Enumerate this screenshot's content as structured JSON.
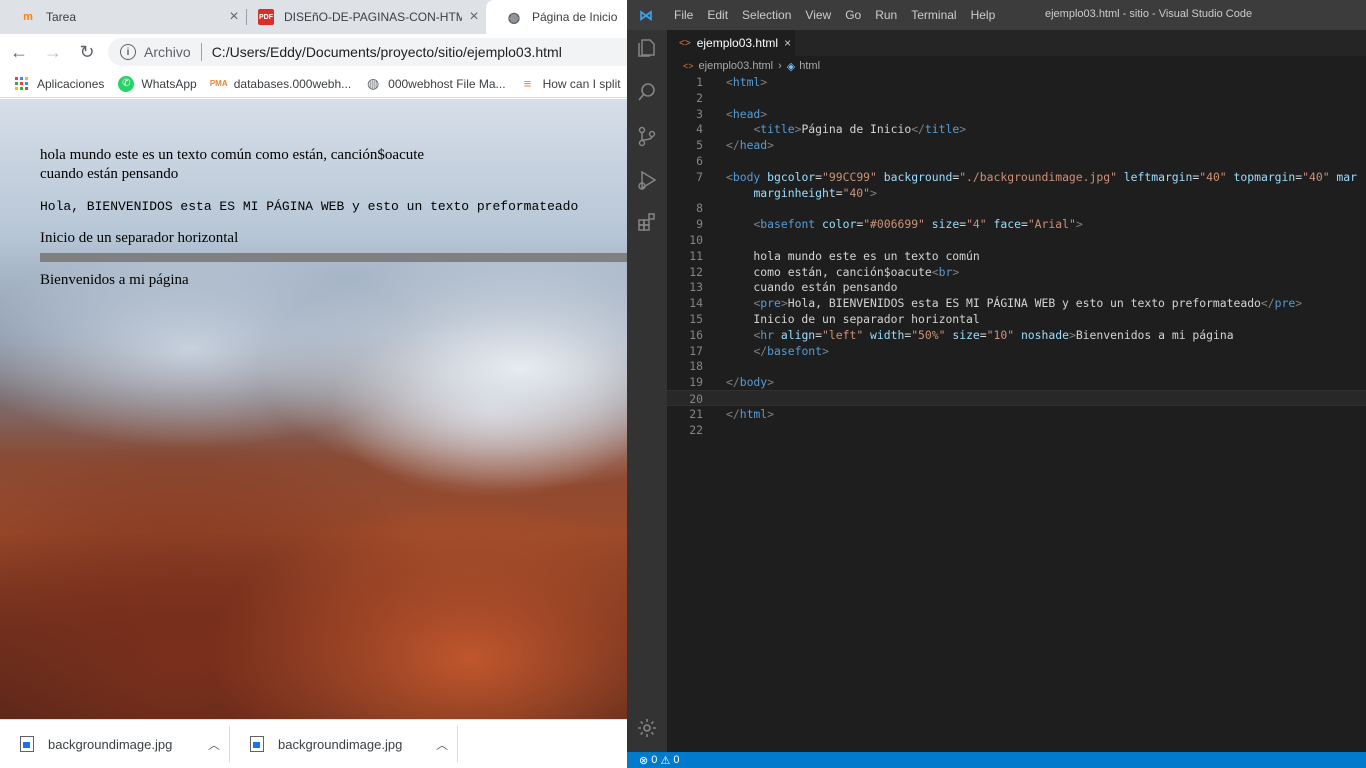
{
  "browser": {
    "tabs": [
      {
        "label": "Tarea",
        "icon": "moodle-icon"
      },
      {
        "label": "DISEñO-DE-PAGINAS-CON-HTM",
        "icon": "pdf-icon"
      },
      {
        "label": "Página de Inicio",
        "icon": "globe-icon"
      }
    ],
    "address_scheme": "Archivo",
    "address_url": "C:/Users/Eddy/Documents/proyecto/sitio/ejemplo03.html",
    "bookmarks": [
      {
        "label": "Aplicaciones",
        "icon": "apps-grid-icon"
      },
      {
        "label": "WhatsApp",
        "icon": "whatsapp-icon"
      },
      {
        "label": "databases.000webh...",
        "icon": "phpmyadmin-icon"
      },
      {
        "label": "000webhost File Ma...",
        "icon": "globe-icon"
      },
      {
        "label": "How can I split",
        "icon": "stackoverflow-icon"
      }
    ],
    "page": {
      "line1": "hola mundo este es un texto común como están, canción$oacute",
      "line2": "cuando están pensando",
      "pre": "Hola, BIENVENIDOS esta ES MI PÁGINA WEB y esto un texto preformateado",
      "separator_text": "Inicio de un separador horizontal",
      "welcome": "Bienvenidos a mi página"
    },
    "downloads": [
      {
        "name": "backgroundimage.jpg"
      },
      {
        "name": "backgroundimage.jpg"
      }
    ]
  },
  "vscode": {
    "menu": [
      "File",
      "Edit",
      "Selection",
      "View",
      "Go",
      "Run",
      "Terminal",
      "Help"
    ],
    "window_title": "ejemplo03.html - sitio - Visual Studio Code",
    "tab_label": "ejemplo03.html",
    "breadcrumb_file": "ejemplo03.html",
    "breadcrumb_symbol": "html",
    "status_errors": "0",
    "status_warnings": "0",
    "code_lines": [
      {
        "n": "1",
        "tokens": [
          {
            "t": "br",
            "v": "<"
          },
          {
            "t": "tg",
            "v": "html"
          },
          {
            "t": "br",
            "v": ">"
          }
        ]
      },
      {
        "n": "2",
        "tokens": []
      },
      {
        "n": "3",
        "tokens": [
          {
            "t": "br",
            "v": "<"
          },
          {
            "t": "tg",
            "v": "head"
          },
          {
            "t": "br",
            "v": ">"
          }
        ]
      },
      {
        "n": "4",
        "tokens": [
          {
            "t": "tx",
            "v": "    "
          },
          {
            "t": "br",
            "v": "<"
          },
          {
            "t": "tg",
            "v": "title"
          },
          {
            "t": "br",
            "v": ">"
          },
          {
            "t": "tx",
            "v": "Página de Inicio"
          },
          {
            "t": "br",
            "v": "</"
          },
          {
            "t": "tg",
            "v": "title"
          },
          {
            "t": "br",
            "v": ">"
          }
        ]
      },
      {
        "n": "5",
        "tokens": [
          {
            "t": "br",
            "v": "</"
          },
          {
            "t": "tg",
            "v": "head"
          },
          {
            "t": "br",
            "v": ">"
          }
        ]
      },
      {
        "n": "6",
        "tokens": []
      },
      {
        "n": "7",
        "tokens": [
          {
            "t": "br",
            "v": "<"
          },
          {
            "t": "tg",
            "v": "body"
          },
          {
            "t": "tx",
            "v": " "
          },
          {
            "t": "at",
            "v": "bgcolor"
          },
          {
            "t": "tx",
            "v": "="
          },
          {
            "t": "st",
            "v": "\"99CC99\""
          },
          {
            "t": "tx",
            "v": " "
          },
          {
            "t": "at",
            "v": "background"
          },
          {
            "t": "tx",
            "v": "="
          },
          {
            "t": "st",
            "v": "\"./backgroundimage.jpg\""
          },
          {
            "t": "tx",
            "v": " "
          },
          {
            "t": "at",
            "v": "leftmargin"
          },
          {
            "t": "tx",
            "v": "="
          },
          {
            "t": "st",
            "v": "\"40\""
          },
          {
            "t": "tx",
            "v": " "
          },
          {
            "t": "at",
            "v": "topmargin"
          },
          {
            "t": "tx",
            "v": "="
          },
          {
            "t": "st",
            "v": "\"40\""
          },
          {
            "t": "tx",
            "v": " "
          },
          {
            "t": "at",
            "v": "mar"
          }
        ]
      },
      {
        "n": "",
        "tokens": [
          {
            "t": "tx",
            "v": "    "
          },
          {
            "t": "at",
            "v": "marginheight"
          },
          {
            "t": "tx",
            "v": "="
          },
          {
            "t": "st",
            "v": "\"40\""
          },
          {
            "t": "br",
            "v": ">"
          }
        ]
      },
      {
        "n": "8",
        "tokens": []
      },
      {
        "n": "9",
        "tokens": [
          {
            "t": "tx",
            "v": "    "
          },
          {
            "t": "br",
            "v": "<"
          },
          {
            "t": "tg",
            "v": "basefont"
          },
          {
            "t": "tx",
            "v": " "
          },
          {
            "t": "at",
            "v": "color"
          },
          {
            "t": "tx",
            "v": "="
          },
          {
            "t": "st",
            "v": "\"#006699\""
          },
          {
            "t": "tx",
            "v": " "
          },
          {
            "t": "at",
            "v": "size"
          },
          {
            "t": "tx",
            "v": "="
          },
          {
            "t": "st",
            "v": "\"4\""
          },
          {
            "t": "tx",
            "v": " "
          },
          {
            "t": "at",
            "v": "face"
          },
          {
            "t": "tx",
            "v": "="
          },
          {
            "t": "st",
            "v": "\"Arial\""
          },
          {
            "t": "br",
            "v": ">"
          }
        ]
      },
      {
        "n": "10",
        "tokens": []
      },
      {
        "n": "11",
        "tokens": [
          {
            "t": "tx",
            "v": "    hola mundo este es un texto común"
          }
        ]
      },
      {
        "n": "12",
        "tokens": [
          {
            "t": "tx",
            "v": "    como están, canción$oacute"
          },
          {
            "t": "br",
            "v": "<"
          },
          {
            "t": "tg",
            "v": "br"
          },
          {
            "t": "br",
            "v": ">"
          }
        ]
      },
      {
        "n": "13",
        "tokens": [
          {
            "t": "tx",
            "v": "    cuando están pensando"
          }
        ]
      },
      {
        "n": "14",
        "tokens": [
          {
            "t": "tx",
            "v": "    "
          },
          {
            "t": "br",
            "v": "<"
          },
          {
            "t": "tg",
            "v": "pre"
          },
          {
            "t": "br",
            "v": ">"
          },
          {
            "t": "tx",
            "v": "Hola, BIENVENIDOS esta ES MI PÁGINA WEB y esto un texto preformateado"
          },
          {
            "t": "br",
            "v": "</"
          },
          {
            "t": "tg",
            "v": "pre"
          },
          {
            "t": "br",
            "v": ">"
          }
        ]
      },
      {
        "n": "15",
        "tokens": [
          {
            "t": "tx",
            "v": "    Inicio de un separador horizontal"
          }
        ]
      },
      {
        "n": "16",
        "tokens": [
          {
            "t": "tx",
            "v": "    "
          },
          {
            "t": "br",
            "v": "<"
          },
          {
            "t": "tg",
            "v": "hr"
          },
          {
            "t": "tx",
            "v": " "
          },
          {
            "t": "at",
            "v": "align"
          },
          {
            "t": "tx",
            "v": "="
          },
          {
            "t": "st",
            "v": "\"left\""
          },
          {
            "t": "tx",
            "v": " "
          },
          {
            "t": "at",
            "v": "width"
          },
          {
            "t": "tx",
            "v": "="
          },
          {
            "t": "st",
            "v": "\"50%\""
          },
          {
            "t": "tx",
            "v": " "
          },
          {
            "t": "at",
            "v": "size"
          },
          {
            "t": "tx",
            "v": "="
          },
          {
            "t": "st",
            "v": "\"10\""
          },
          {
            "t": "tx",
            "v": " "
          },
          {
            "t": "at",
            "v": "noshade"
          },
          {
            "t": "br",
            "v": ">"
          },
          {
            "t": "tx",
            "v": "Bienvenidos a mi página"
          }
        ]
      },
      {
        "n": "17",
        "tokens": [
          {
            "t": "tx",
            "v": "    "
          },
          {
            "t": "br",
            "v": "</"
          },
          {
            "t": "tg",
            "v": "basefont"
          },
          {
            "t": "br",
            "v": ">"
          }
        ]
      },
      {
        "n": "18",
        "tokens": []
      },
      {
        "n": "19",
        "tokens": [
          {
            "t": "br",
            "v": "</"
          },
          {
            "t": "tg",
            "v": "body"
          },
          {
            "t": "br",
            "v": ">"
          }
        ]
      },
      {
        "n": "20",
        "tokens": [],
        "current": true
      },
      {
        "n": "21",
        "tokens": [
          {
            "t": "br",
            "v": "</"
          },
          {
            "t": "tg",
            "v": "html"
          },
          {
            "t": "br",
            "v": ">"
          }
        ]
      },
      {
        "n": "22",
        "tokens": []
      }
    ]
  },
  "colors": {
    "vscode_bg": "#1e1e1e",
    "status_bar": "#007acc",
    "tag": "#569cd6",
    "attr": "#9cdcfe",
    "string": "#ce9178"
  }
}
